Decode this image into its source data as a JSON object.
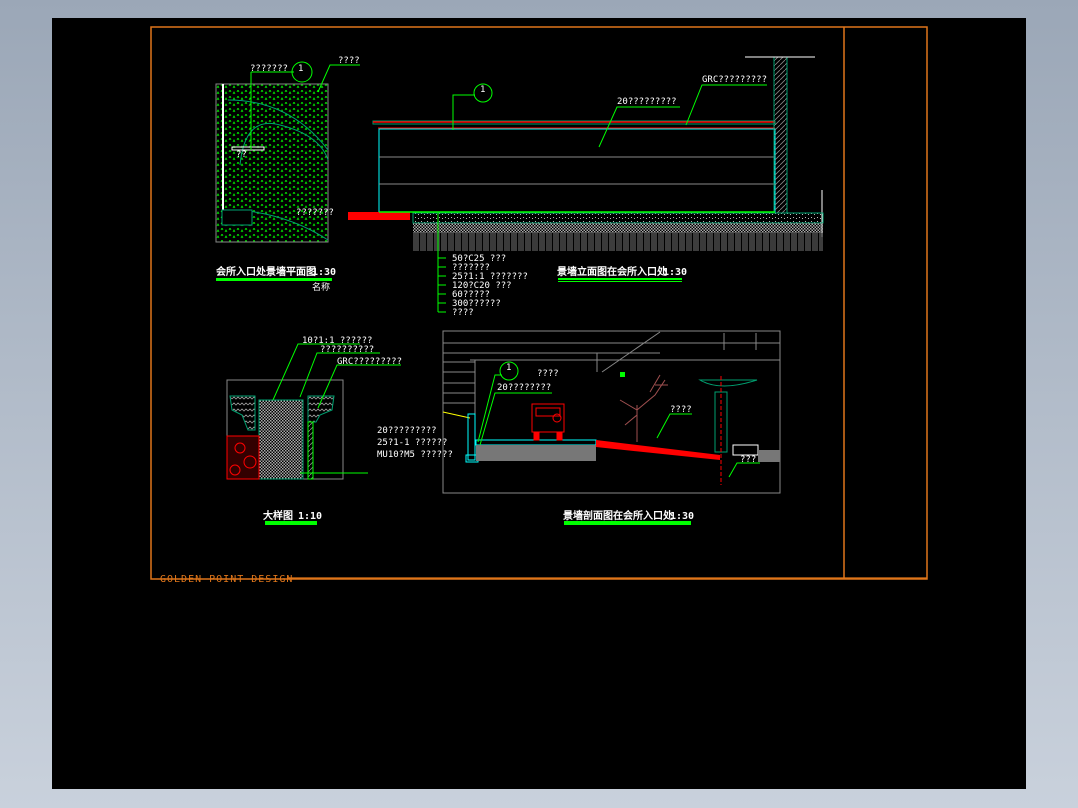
{
  "brand": "GOLDEN POINT DESIGN",
  "plan": {
    "title": "会所入口处景墙平面图",
    "scale": "1:30",
    "sub": "名称",
    "labels": [
      "???????",
      "????",
      "??",
      "???????"
    ],
    "marker": "1"
  },
  "elevation": {
    "title": "景墙立面图在会所入口处",
    "scale": "1:30",
    "labels": [
      "20?????????",
      "GRC?????????"
    ],
    "layers": [
      "50?C25   ???",
      "???????",
      "25?1:1   ???????",
      "120?C20   ???",
      "60?????",
      "300??????",
      "????"
    ],
    "marker": "1"
  },
  "detail": {
    "title": "大样图",
    "scale": "1:10",
    "labels": [
      "10?1:1  ??????",
      "??????????",
      "GRC?????????"
    ],
    "side": [
      "20?????????",
      "25?1-1  ??????",
      "MU10?M5  ??????"
    ]
  },
  "section": {
    "title": "景墙剖面图在会所入口处",
    "scale": "1:30",
    "labels": [
      "????",
      "20????????",
      "????",
      "???"
    ],
    "marker": "1"
  },
  "colors": {
    "frame": "#e0761a",
    "leader": "#00ff00",
    "hatch": "#00a070",
    "red": "#ff0000",
    "cyan": "#00ffff"
  }
}
